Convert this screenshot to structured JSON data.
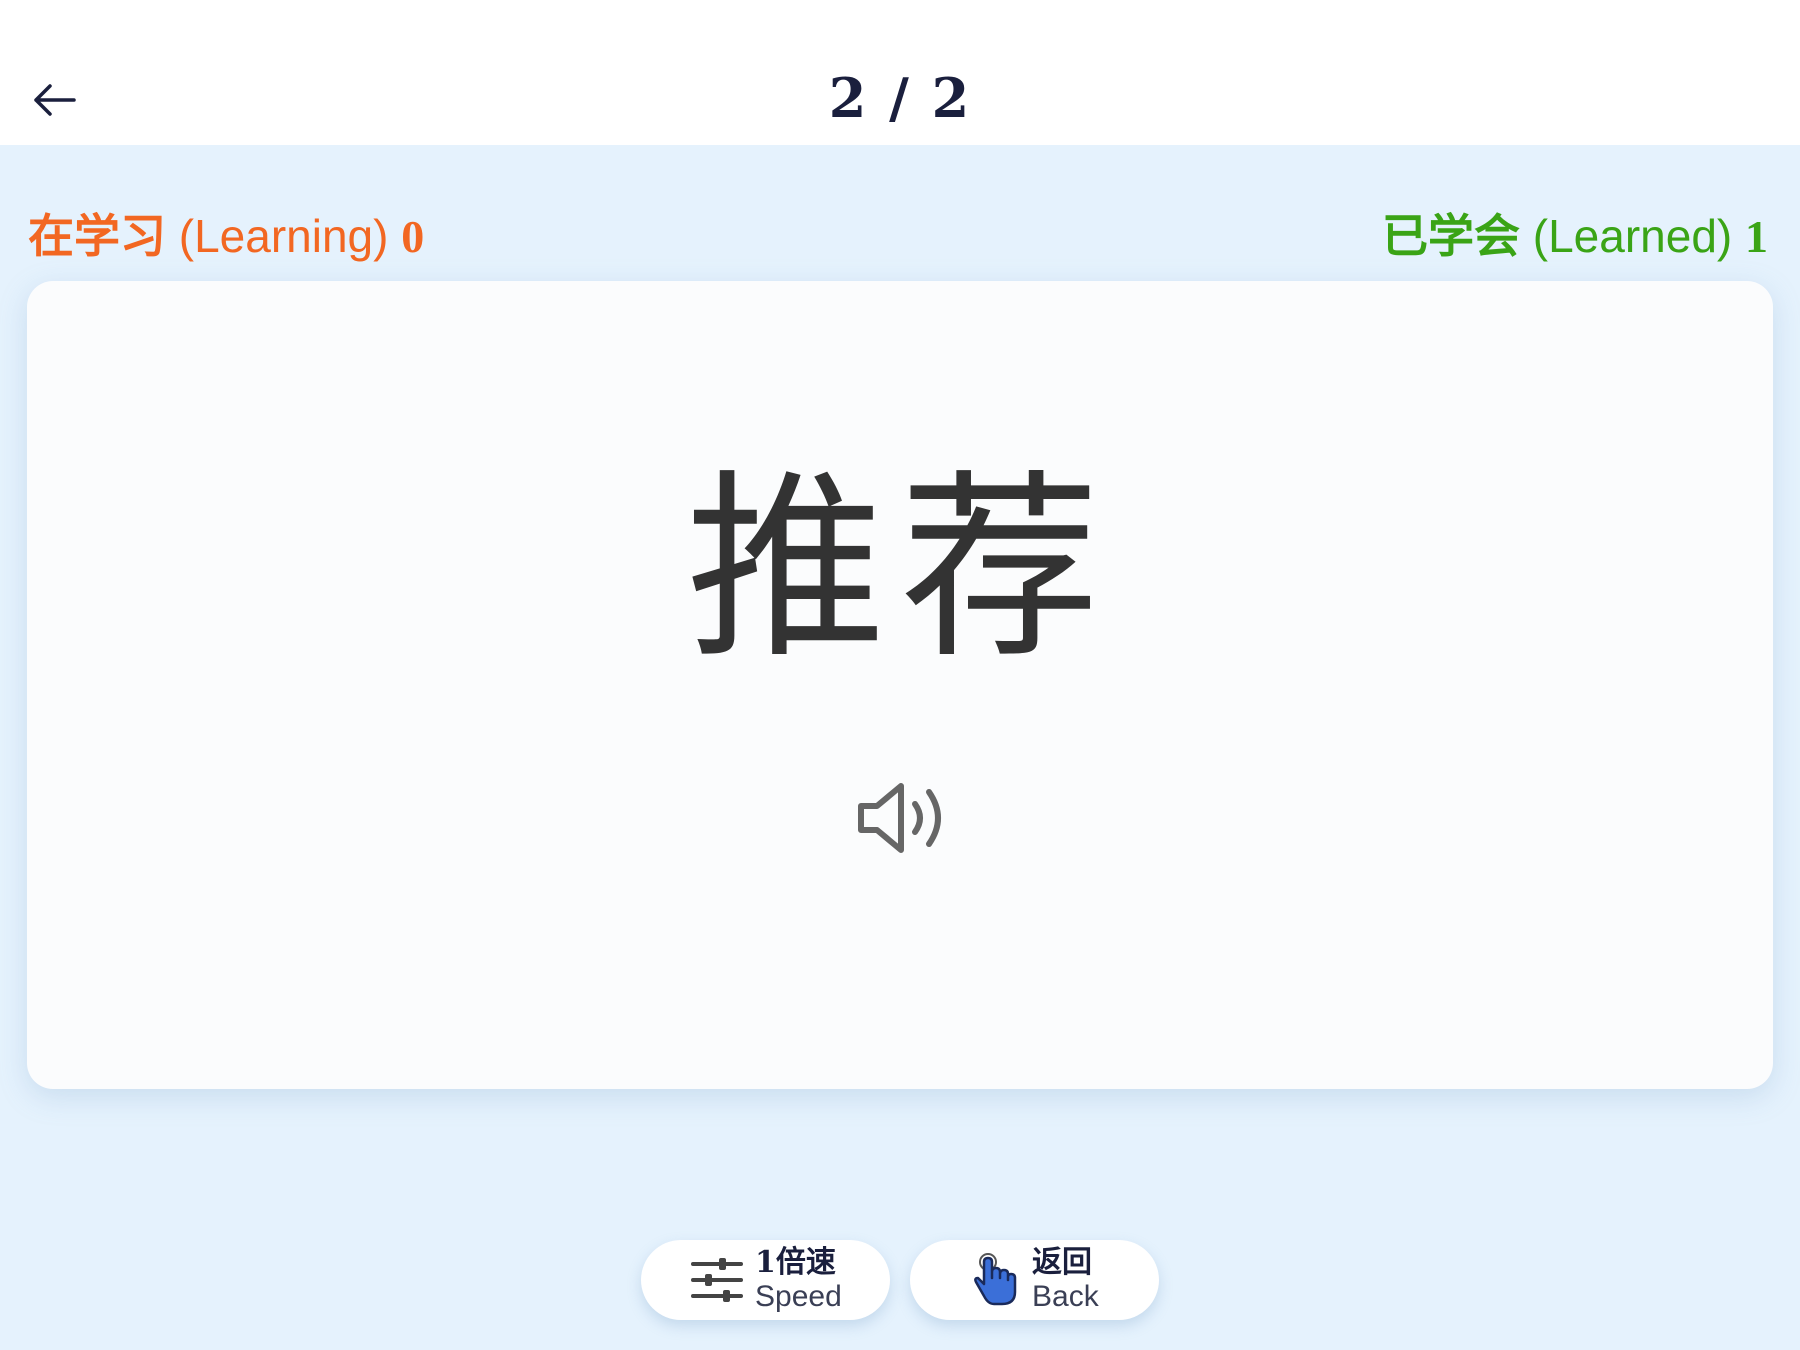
{
  "header": {
    "back_icon": "arrow-left-icon",
    "counter": "2 / 2"
  },
  "status": {
    "learning": {
      "zh": "在学习",
      "en": "(Learning)",
      "count": "0",
      "color": "#f26722"
    },
    "learned": {
      "zh": "已学会",
      "en": "(Learned)",
      "count": "1",
      "color": "#3aa416"
    }
  },
  "card": {
    "word": "推荐",
    "audio_icon": "speaker-icon"
  },
  "controls": {
    "speed": {
      "zh": "1倍速",
      "en": "Speed",
      "icon": "sliders-icon"
    },
    "back": {
      "zh": "返回",
      "en": "Back",
      "icon": "hand-pointer-icon"
    }
  }
}
